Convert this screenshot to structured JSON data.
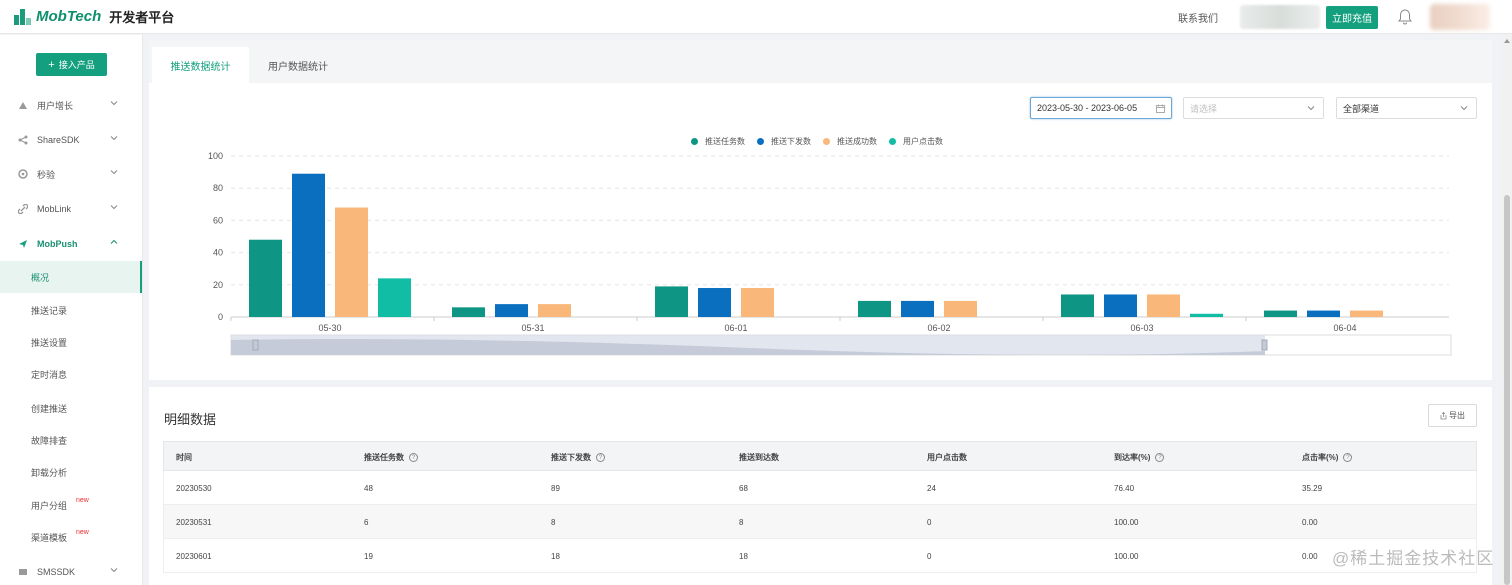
{
  "header": {
    "brand": "MobTech",
    "brand_sub": "开发者平台",
    "contact": "联系我们",
    "recharge": "立即充值"
  },
  "sidebar": {
    "add_product": "接入产品",
    "items": [
      {
        "label": "用户增长",
        "icon": "growth-icon"
      },
      {
        "label": "ShareSDK",
        "icon": "share-icon"
      },
      {
        "label": "秒验",
        "icon": "verify-icon"
      },
      {
        "label": "MobLink",
        "icon": "link-icon"
      },
      {
        "label": "MobPush",
        "icon": "push-icon"
      },
      {
        "label": "SMSSDK",
        "icon": "sms-icon"
      }
    ],
    "sub_items": [
      {
        "label": "概况",
        "new": ""
      },
      {
        "label": "推送记录",
        "new": ""
      },
      {
        "label": "推送设置",
        "new": ""
      },
      {
        "label": "定时消息",
        "new": ""
      },
      {
        "label": "创建推送",
        "new": ""
      },
      {
        "label": "故障排查",
        "new": ""
      },
      {
        "label": "卸载分析",
        "new": ""
      },
      {
        "label": "用户分组",
        "new": "new"
      },
      {
        "label": "渠道模板",
        "new": "new"
      }
    ]
  },
  "tabs": {
    "active": "推送数据统计",
    "other": "用户数据统计"
  },
  "filters": {
    "date_range": "2023-05-30 - 2023-06-05",
    "select_placeholder": "请选择",
    "channel": "全部渠道"
  },
  "colors": {
    "accent": "#14a07e",
    "series": [
      "#0e9584",
      "#0b6fc0",
      "#f9b77a",
      "#12bda6"
    ]
  },
  "chart_data": {
    "type": "bar",
    "categories": [
      "05-30",
      "05-31",
      "06-01",
      "06-02",
      "06-03",
      "06-04"
    ],
    "series": [
      {
        "name": "推送任务数",
        "values": [
          48,
          6,
          19,
          10,
          14,
          4
        ]
      },
      {
        "name": "推送下发数",
        "values": [
          89,
          8,
          18,
          10,
          14,
          4
        ]
      },
      {
        "name": "推送成功数",
        "values": [
          68,
          8,
          18,
          10,
          14,
          4
        ]
      },
      {
        "name": "用户点击数",
        "values": [
          24,
          0,
          0,
          0,
          2,
          0
        ]
      }
    ],
    "ylim": [
      0,
      100
    ],
    "yticks": [
      0,
      20,
      40,
      60,
      80,
      100
    ],
    "grid": true,
    "legend": "top-center"
  },
  "detail": {
    "title": "明细数据",
    "export": "导出",
    "columns": [
      "时间",
      "推送任务数",
      "推送下发数",
      "推送到达数",
      "用户点击数",
      "到达率(%)",
      "点击率(%)"
    ],
    "help_columns": [
      false,
      true,
      true,
      false,
      false,
      true,
      true
    ],
    "rows": [
      [
        "20230530",
        "48",
        "89",
        "68",
        "24",
        "76.40",
        "35.29"
      ],
      [
        "20230531",
        "6",
        "8",
        "8",
        "0",
        "100.00",
        "0.00"
      ],
      [
        "20230601",
        "19",
        "18",
        "18",
        "0",
        "100.00",
        "0.00"
      ]
    ]
  },
  "watermark": "@稀土掘金技术社区"
}
